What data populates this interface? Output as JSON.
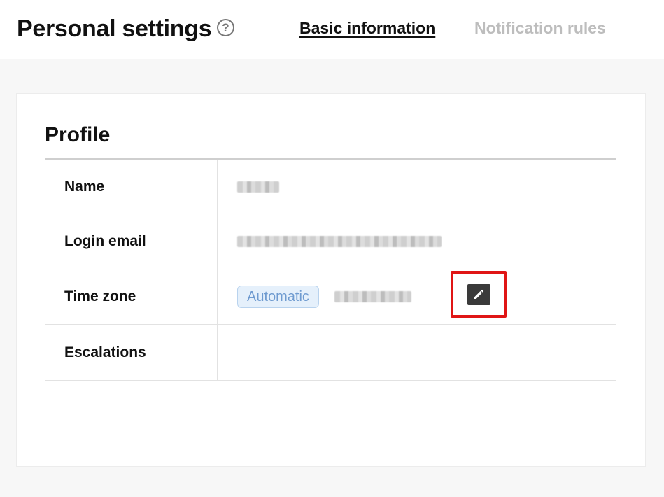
{
  "header": {
    "title": "Personal settings",
    "help_icon": "question-circle-icon",
    "help_glyph": "?",
    "tabs": [
      {
        "label": "Basic information",
        "active": true
      },
      {
        "label": "Notification rules",
        "active": false
      }
    ]
  },
  "profile": {
    "title": "Profile",
    "rows": [
      {
        "label": "Name"
      },
      {
        "label": "Login email"
      },
      {
        "label": "Time zone",
        "badge": "Automatic",
        "edit_icon": "pencil-icon"
      },
      {
        "label": "Escalations"
      }
    ]
  },
  "colors": {
    "highlight": "#e01515",
    "badge_bg": "#e5f0fb",
    "badge_text": "#6f9bd0",
    "inactive_tab": "#bdbdbd"
  }
}
